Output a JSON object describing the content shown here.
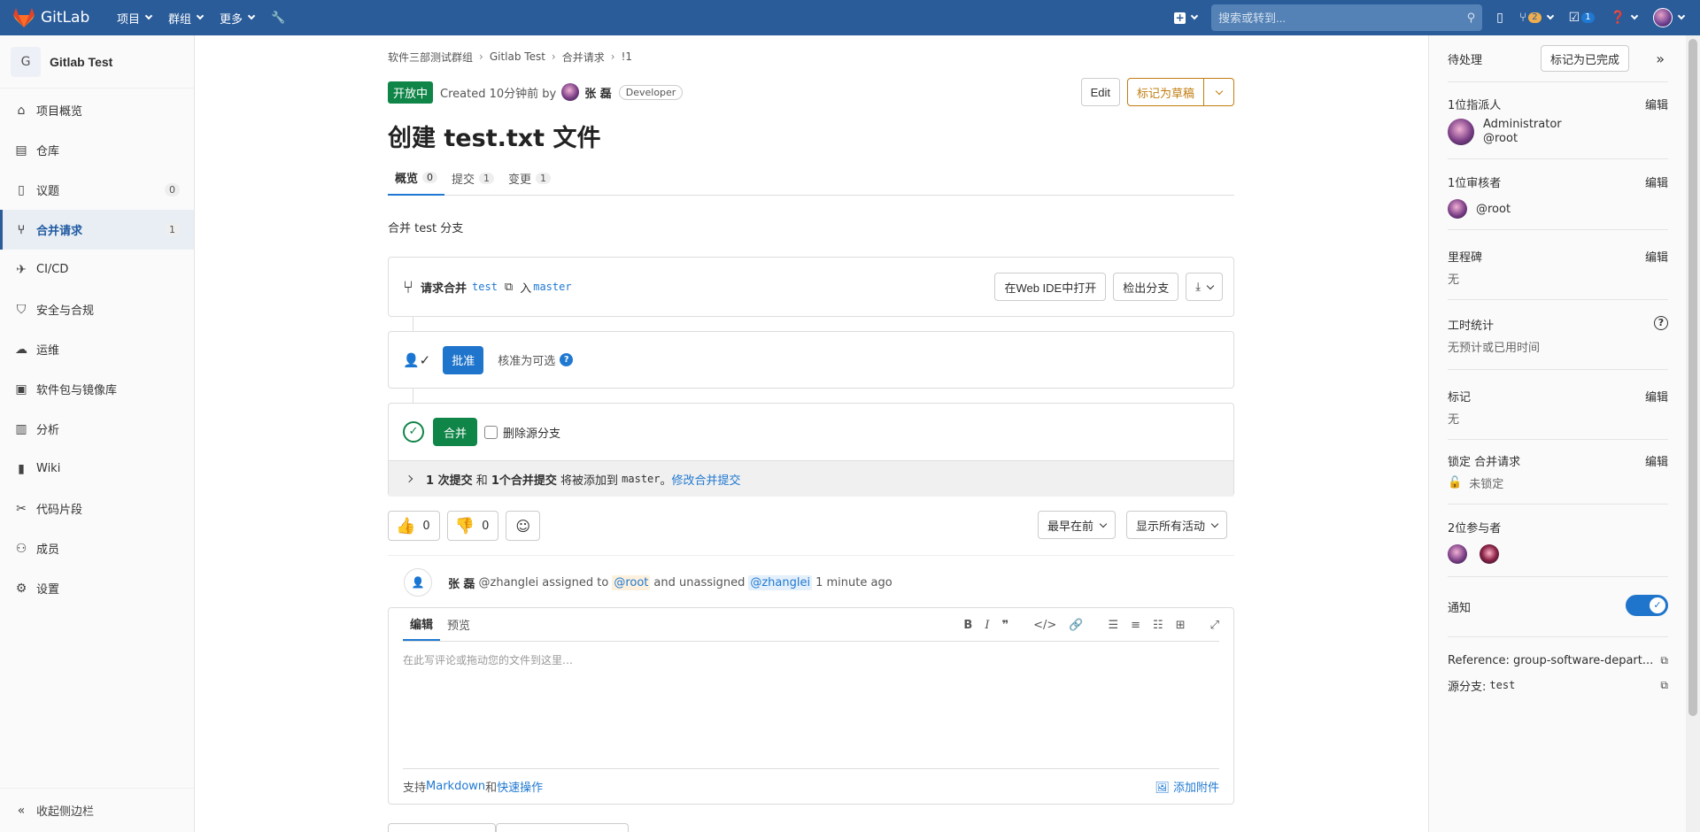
{
  "topbar": {
    "brand": "GitLab",
    "nav": [
      "项目",
      "群组",
      "更多"
    ],
    "search_placeholder": "搜索或转到...",
    "mr_count": "2",
    "todo_count": "1",
    "brand_color": "#2a5c9a"
  },
  "sidebar": {
    "project_initial": "G",
    "project_name": "Gitlab Test",
    "items": [
      {
        "label": "项目概览",
        "icon": "home-icon"
      },
      {
        "label": "仓库",
        "icon": "repository-icon"
      },
      {
        "label": "议题",
        "icon": "issues-icon",
        "count": "0"
      },
      {
        "label": "合并请求",
        "icon": "merge-request-icon",
        "count": "1",
        "active": true
      },
      {
        "label": "CI/CD",
        "icon": "rocket-icon"
      },
      {
        "label": "安全与合规",
        "icon": "shield-icon"
      },
      {
        "label": "运维",
        "icon": "cloud-icon"
      },
      {
        "label": "软件包与镜像库",
        "icon": "package-icon"
      },
      {
        "label": "分析",
        "icon": "chart-icon"
      },
      {
        "label": "Wiki",
        "icon": "book-icon"
      },
      {
        "label": "代码片段",
        "icon": "snippet-icon"
      },
      {
        "label": "成员",
        "icon": "users-icon"
      },
      {
        "label": "设置",
        "icon": "gear-icon"
      }
    ],
    "collapse_label": "收起侧边栏"
  },
  "breadcrumb": [
    "软件三部测试群组",
    "Gitlab Test",
    "合并请求",
    "!1"
  ],
  "mr": {
    "status": "开放中",
    "created": "Created 10分钟前 by",
    "author": "张 磊",
    "role": "Developer",
    "edit_label": "Edit",
    "draft_label": "标记为草稿",
    "title": "创建 test.txt 文件",
    "tabs": [
      {
        "label": "概览",
        "count": "0"
      },
      {
        "label": "提交",
        "count": "1"
      },
      {
        "label": "变更",
        "count": "1"
      }
    ],
    "description": "合并 test 分支",
    "request_label": "请求合并",
    "source_branch": "test",
    "into_label": "入",
    "target_branch": "master",
    "webide_label": "在Web IDE中打开",
    "checkout_label": "检出分支",
    "approve_label": "批准",
    "approval_optional": "核准为可选",
    "merge_label": "合并",
    "delete_branch_label": "删除源分支",
    "commits_info": {
      "commits": "1 次提交",
      "and": " 和 ",
      "merge_commits": "1个合并提交",
      "will_add": " 将被添加到 ",
      "branch": "master",
      "suffix": "。",
      "modify_link": "修改合并提交"
    },
    "thumbs_up": "0",
    "thumbs_down": "0",
    "sort_label": "最早在前",
    "filter_label": "显示所有活动",
    "activity": {
      "author": "张 磊",
      "username": "@zhanglei",
      "assigned_to": "assigned to",
      "mention_root": "@root",
      "and_unassigned": "and unassigned",
      "mention_self": "@zhanglei",
      "time": "1 minute ago"
    },
    "editor": {
      "tab_write": "编辑",
      "tab_preview": "预览",
      "placeholder": "在此写评论或拖动您的文件到这里…",
      "support_prefix": "支持",
      "markdown_link": "Markdown",
      "and": "和",
      "quick_actions_link": "快速操作",
      "attach_label": "添加附件"
    }
  },
  "rside": {
    "todo_label": "待处理",
    "mark_done": "标记为已完成",
    "assignee_title": "1位指派人",
    "edit": "编辑",
    "assignee_name": "Administrator",
    "assignee_user": "@root",
    "reviewer_title": "1位审核者",
    "reviewer_user": "@root",
    "milestone_title": "里程碑",
    "milestone_val": "无",
    "time_title": "工时统计",
    "time_val": "无预计或已用时间",
    "labels_title": "标记",
    "labels_val": "无",
    "lock_title": "锁定 合并请求",
    "lock_val": "未锁定",
    "participants_title": "2位参与者",
    "notify_title": "通知",
    "notify_on": true,
    "reference": "Reference: group-software-depart...",
    "source_branch_label": "源分支:",
    "source_branch": "test"
  }
}
